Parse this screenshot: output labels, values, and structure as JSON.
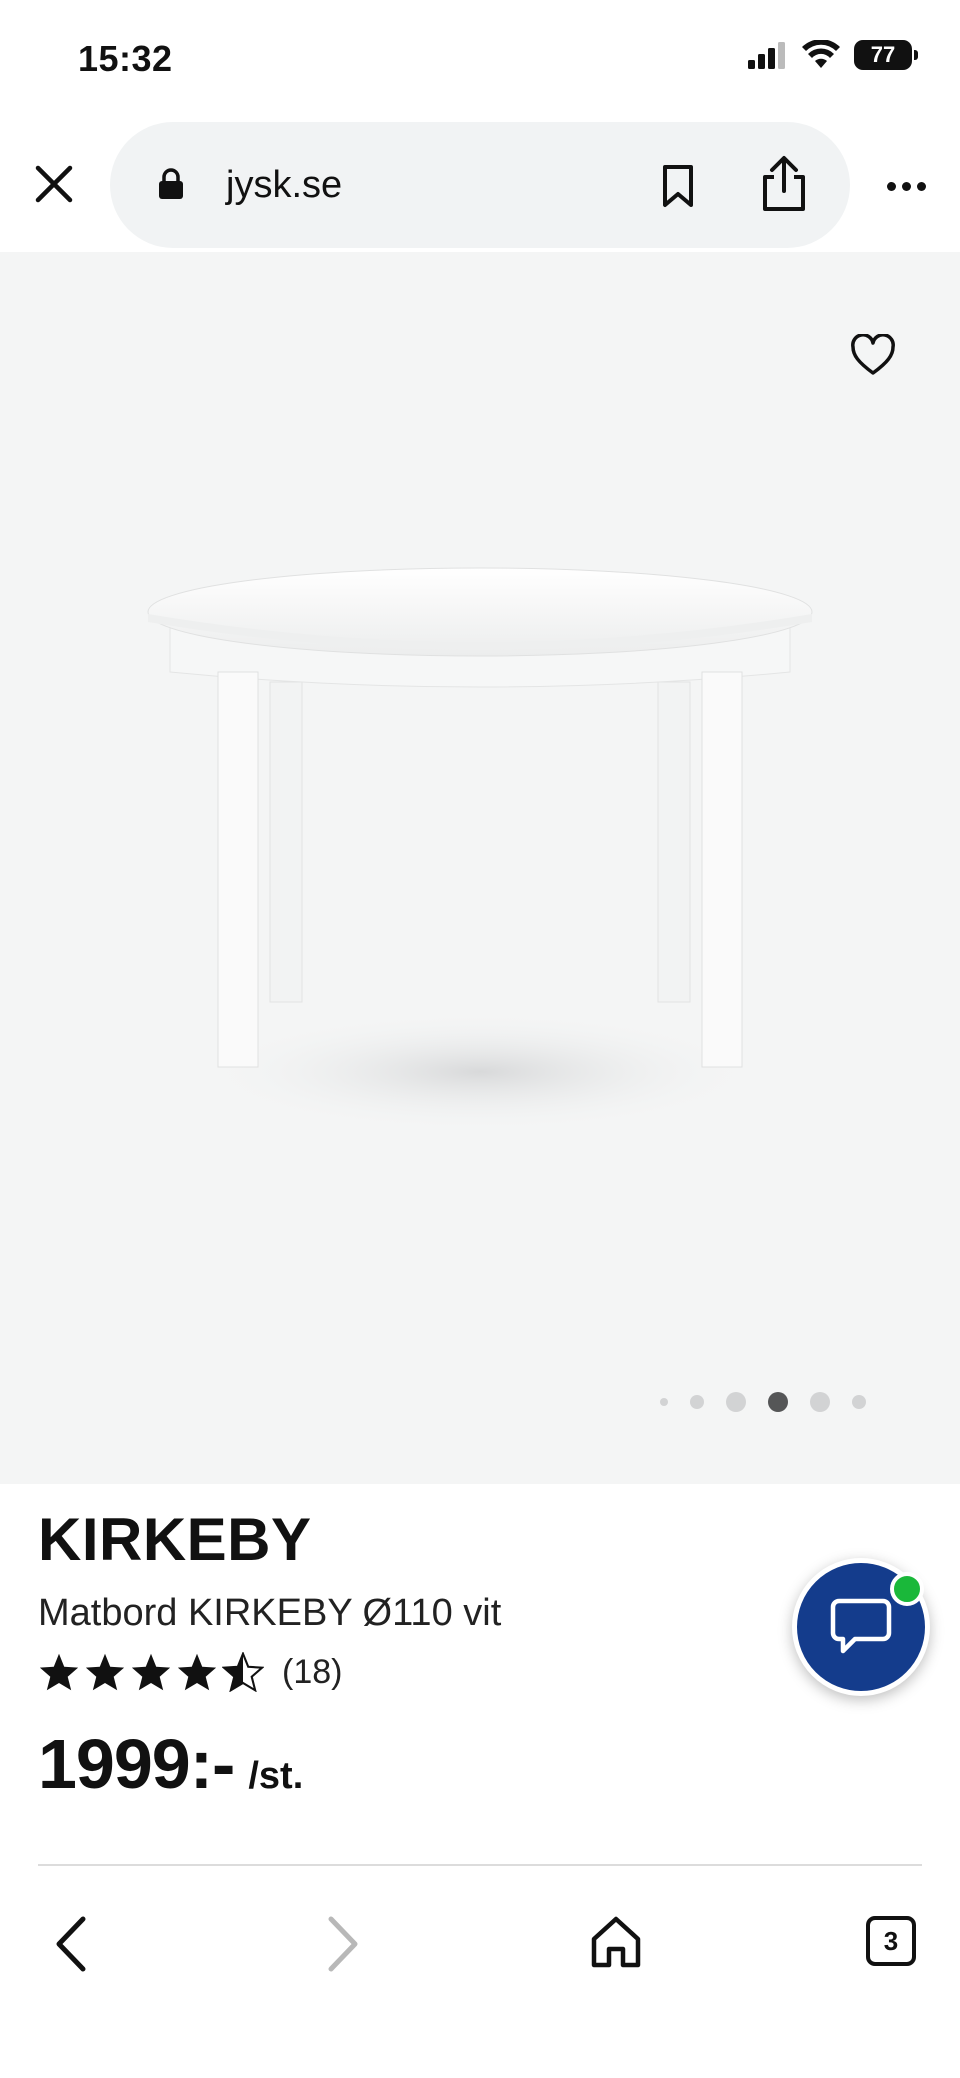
{
  "status_bar": {
    "time": "15:32",
    "battery": "77"
  },
  "browser": {
    "url": "jysk.se",
    "tab_count": "3"
  },
  "product": {
    "name": "KIRKEBY",
    "description": "Matbord KIRKEBY Ø110 vit",
    "rating": 4.5,
    "review_count": "(18)",
    "price": "1999:-",
    "unit": "/st."
  },
  "carousel": {
    "total": 6,
    "active_index": 3
  },
  "colors": {
    "chat_button": "#143c8c",
    "online_badge": "#1ab83a",
    "image_background": "#f4f5f5",
    "url_bar": "#f1f3f4"
  },
  "icons": {
    "close": "close-icon",
    "lock": "lock-icon",
    "bookmark": "bookmark-icon",
    "share": "share-icon",
    "more": "more-icon",
    "favorite": "heart-icon",
    "chat": "chat-bubble-icon",
    "back": "chevron-left-icon",
    "forward": "chevron-right-icon",
    "home": "home-icon",
    "tabs": "tabs-icon"
  }
}
